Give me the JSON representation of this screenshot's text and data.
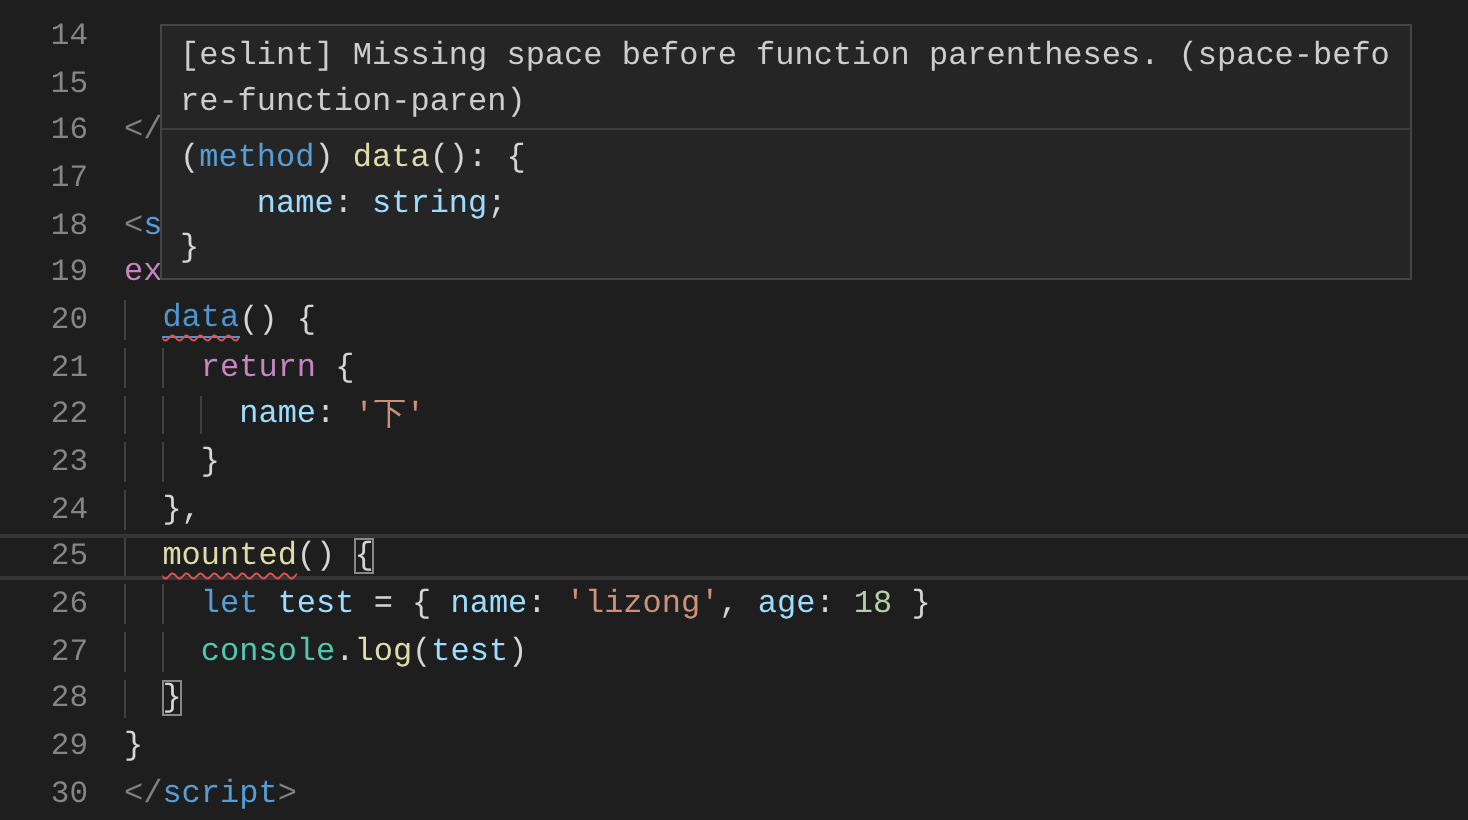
{
  "editor": {
    "lines": [
      {
        "number": "14",
        "current": false
      },
      {
        "number": "15",
        "current": false
      },
      {
        "number": "16",
        "current": false,
        "tokens": [
          {
            "text": "</",
            "kind": "punct"
          }
        ]
      },
      {
        "number": "17",
        "current": false
      },
      {
        "number": "18",
        "current": false,
        "tokens": [
          {
            "text": "<",
            "kind": "punct"
          },
          {
            "text": "s",
            "kind": "tag"
          }
        ]
      },
      {
        "number": "19",
        "current": false,
        "tokens": [
          {
            "text": "ex",
            "kind": "control"
          }
        ]
      },
      {
        "number": "20",
        "current": false,
        "tokens": [
          {
            "text": "  data",
            "kind": "link",
            "squiggle": true
          },
          {
            "text": "() {",
            "kind": "plain"
          }
        ]
      },
      {
        "number": "21",
        "current": false,
        "tokens": [
          {
            "text": "    return",
            "kind": "control"
          },
          {
            "text": " {",
            "kind": "plain"
          }
        ]
      },
      {
        "number": "22",
        "current": false,
        "tokens": [
          {
            "text": "      name",
            "kind": "property"
          },
          {
            "text": ": ",
            "kind": "plain"
          },
          {
            "text": "'下'",
            "kind": "string"
          }
        ]
      },
      {
        "number": "23",
        "current": false,
        "tokens": [
          {
            "text": "    }",
            "kind": "plain"
          }
        ]
      },
      {
        "number": "24",
        "current": false,
        "tokens": [
          {
            "text": "  },",
            "kind": "plain"
          }
        ]
      },
      {
        "number": "25",
        "current": true,
        "tokens": [
          {
            "text": "  mounted",
            "kind": "function",
            "squiggle": true
          },
          {
            "text": "() ",
            "kind": "plain"
          },
          {
            "text": "{",
            "kind": "plain",
            "matched": true
          }
        ]
      },
      {
        "number": "26",
        "current": false,
        "tokens": [
          {
            "text": "    let",
            "kind": "keyword"
          },
          {
            "text": " test",
            "kind": "property"
          },
          {
            "text": " = { ",
            "kind": "plain"
          },
          {
            "text": "name",
            "kind": "property"
          },
          {
            "text": ": ",
            "kind": "plain"
          },
          {
            "text": "'lizong'",
            "kind": "string"
          },
          {
            "text": ", ",
            "kind": "plain"
          },
          {
            "text": "age",
            "kind": "property"
          },
          {
            "text": ": ",
            "kind": "plain"
          },
          {
            "text": "18",
            "kind": "number"
          },
          {
            "text": " }",
            "kind": "plain"
          }
        ]
      },
      {
        "number": "27",
        "current": false,
        "tokens": [
          {
            "text": "    console",
            "kind": "type"
          },
          {
            "text": ".",
            "kind": "plain"
          },
          {
            "text": "log",
            "kind": "function"
          },
          {
            "text": "(",
            "kind": "plain"
          },
          {
            "text": "test",
            "kind": "property"
          },
          {
            "text": ")",
            "kind": "plain"
          }
        ]
      },
      {
        "number": "28",
        "current": false,
        "tokens": [
          {
            "text": "  }",
            "kind": "plain",
            "matched": true
          }
        ]
      },
      {
        "number": "29",
        "current": false,
        "tokens": [
          {
            "text": "}",
            "kind": "plain"
          }
        ]
      },
      {
        "number": "30",
        "current": false,
        "tokens": [
          {
            "text": "</",
            "kind": "punct"
          },
          {
            "text": "script",
            "kind": "tag"
          },
          {
            "text": ">",
            "kind": "punct"
          }
        ]
      }
    ]
  },
  "hover": {
    "message": "[eslint] Missing space before function parentheses. (space-before-function-paren)",
    "signature": [
      [
        {
          "text": "(",
          "kind": "plain"
        },
        {
          "text": "method",
          "kind": "keyword"
        },
        {
          "text": ") ",
          "kind": "plain"
        },
        {
          "text": "data",
          "kind": "function"
        },
        {
          "text": "(): {",
          "kind": "plain"
        }
      ],
      [
        {
          "text": "    name",
          "kind": "property"
        },
        {
          "text": ": ",
          "kind": "plain"
        },
        {
          "text": "string",
          "kind": "property"
        },
        {
          "text": ";",
          "kind": "plain"
        }
      ],
      [
        {
          "text": "}",
          "kind": "plain"
        }
      ]
    ]
  }
}
